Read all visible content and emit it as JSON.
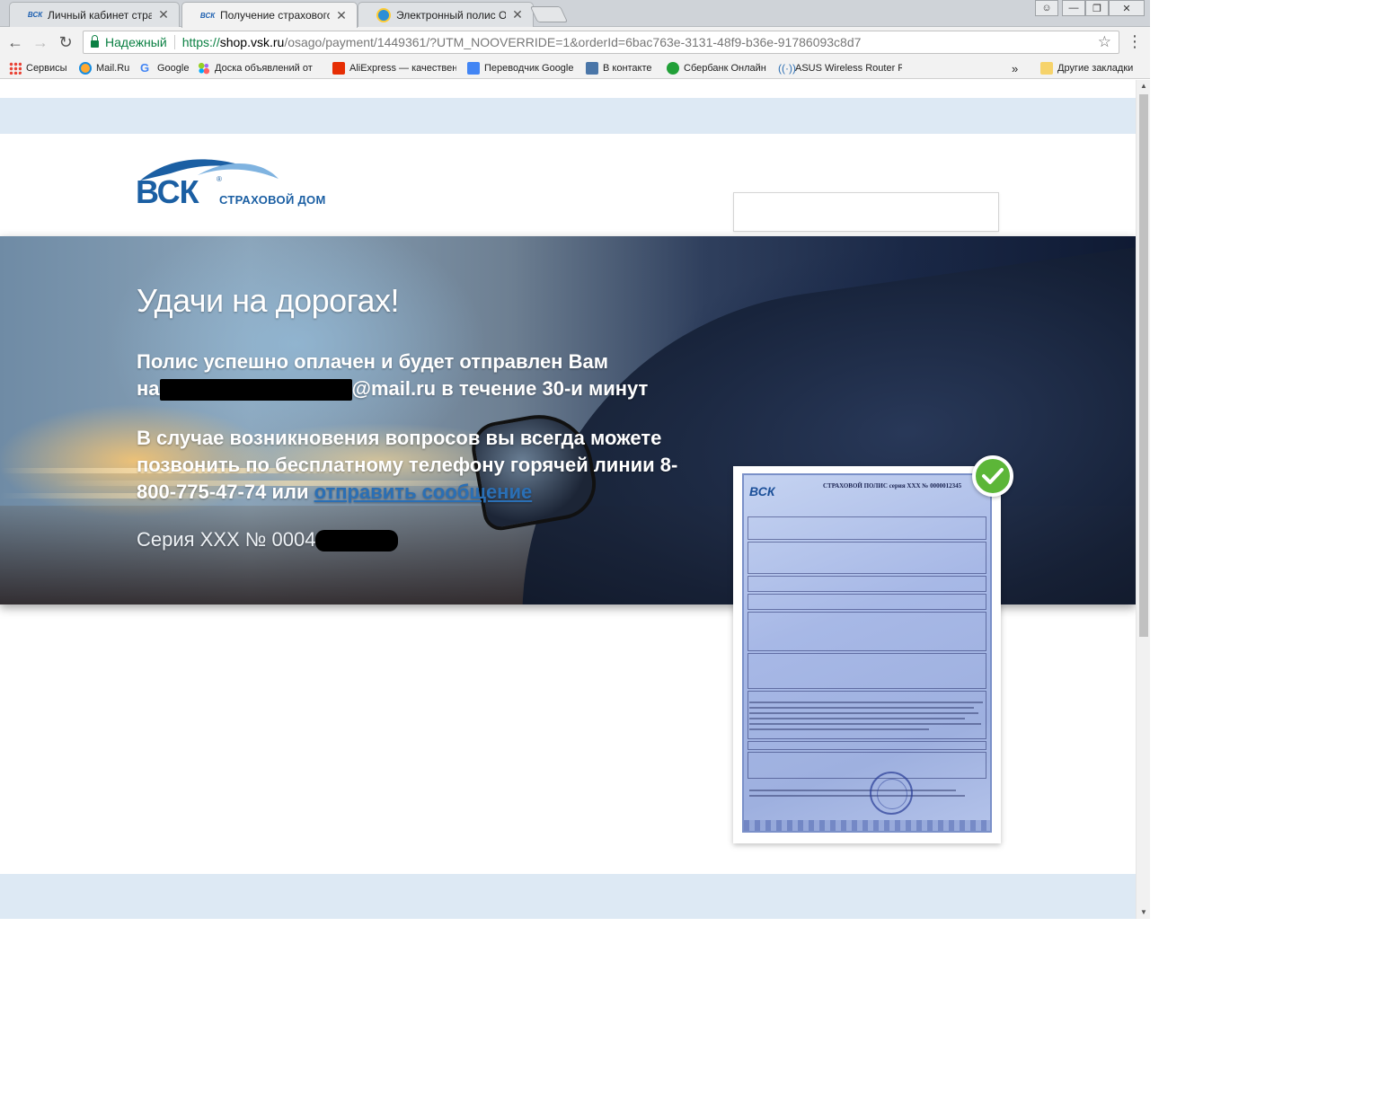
{
  "browser": {
    "tabs": [
      {
        "favicon": "vsk-favicon",
        "title": "Личный кабинет страхов",
        "active": false
      },
      {
        "favicon": "vsk-favicon",
        "title": "Получение страхового по",
        "active": true
      },
      {
        "favicon": "globe-favicon",
        "title": "Электронный полис ОСАГ",
        "active": false
      }
    ],
    "address_bar": {
      "security_label": "Надежный",
      "url_scheme": "https://",
      "url_host": "shop.vsk.ru",
      "url_path": "/osago/payment/1449361/?UTM_NOOVERRIDE=1&orderId=6bac763e-3131-48f9-b36e-91786093c8d7"
    },
    "bookmarks": [
      {
        "icon": "apps-grid-icon",
        "label": "Сервисы"
      },
      {
        "icon": "mailru-icon",
        "label": "Mail.Ru"
      },
      {
        "icon": "google-icon",
        "label": "Google"
      },
      {
        "icon": "avito-icon",
        "label": "Доска объявлений от"
      },
      {
        "icon": "aliexpress-icon",
        "label": "AliExpress — качествен"
      },
      {
        "icon": "google-translate-icon",
        "label": "Переводчик Google"
      },
      {
        "icon": "vk-icon",
        "label": "В контакте"
      },
      {
        "icon": "sberbank-icon",
        "label": "Сбербанк Онлайн"
      },
      {
        "icon": "wifi-icon",
        "label": "ASUS Wireless Router R"
      }
    ],
    "bookmarks_overflow": "»",
    "other_bookmarks": "Другие закладки"
  },
  "page": {
    "logo": {
      "brand": "ВСК",
      "registered": "®",
      "subtitle": "СТРАХОВОЙ ДОМ"
    },
    "hero": {
      "title": "Удачи на дорогах!",
      "paid_line1": "Полис успешно оплачен и будет отправлен Вам",
      "paid_prefix": "на",
      "email_domain": "@mail.ru",
      "paid_suffix": " в течение 30-и минут",
      "support_text": "В случае возникновения вопросов вы всегда можете позвонить по бесплатному телефону горячей линии 8-800-775-47-74 или ",
      "support_link": "отправить сообщение",
      "series_label": "Серия ХХХ № 0004"
    },
    "policy_preview": {
      "doc_logo": "ВСК",
      "doc_title": "СТРАХОВОЙ ПОЛИС серия ХХХ № 0000012345"
    }
  },
  "colors": {
    "band": "#dde9f4",
    "brand_blue": "#1b5fa3",
    "link": "#2a6fb5",
    "check_green": "#5cb638",
    "secure_green": "#0b8043"
  }
}
